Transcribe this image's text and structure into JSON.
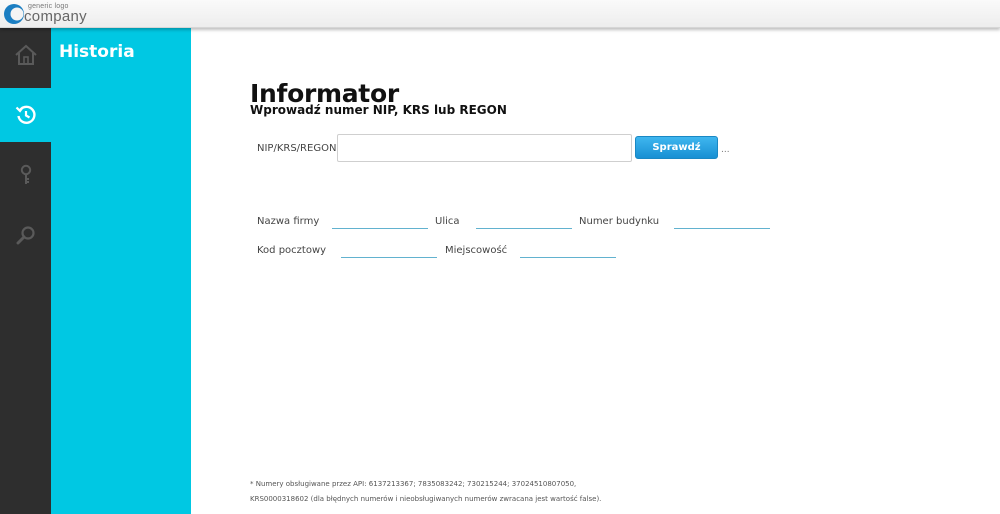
{
  "logo": {
    "small_text": "generic logo",
    "big_text": "company"
  },
  "rail": {
    "items": [
      {
        "icon": "home-icon",
        "active": false
      },
      {
        "icon": "history-icon",
        "active": true
      },
      {
        "icon": "key-icon",
        "active": false
      },
      {
        "icon": "search-icon",
        "active": false
      }
    ]
  },
  "panel": {
    "title": "Historia"
  },
  "main": {
    "title": "Informator",
    "subtitle": "Wprowadź numer NIP, KRS lub REGON",
    "query": {
      "label": "NIP/KRS/REGON",
      "value": "",
      "placeholder": "",
      "button_label": "Sprawdź",
      "ellipsis": "..."
    },
    "fields": {
      "company_name_label": "Nazwa firmy",
      "street_label": "Ulica",
      "building_label": "Numer budynku",
      "postal_label": "Kod pocztowy",
      "city_label": "Miejscowość"
    },
    "footnote": {
      "line1": "* Numery obsługiwane przez API: 6137213367; 7835083242; 730215244; 37024510807050,",
      "line2": "KRS0000318602 (dla błędnych numerów i nieobsługiwanych numerów zwracana jest wartość false)."
    }
  },
  "colors": {
    "accent": "#00c8e3",
    "rail": "#2e2e2e",
    "button": "#1890d3",
    "underline": "#62b2cf"
  }
}
